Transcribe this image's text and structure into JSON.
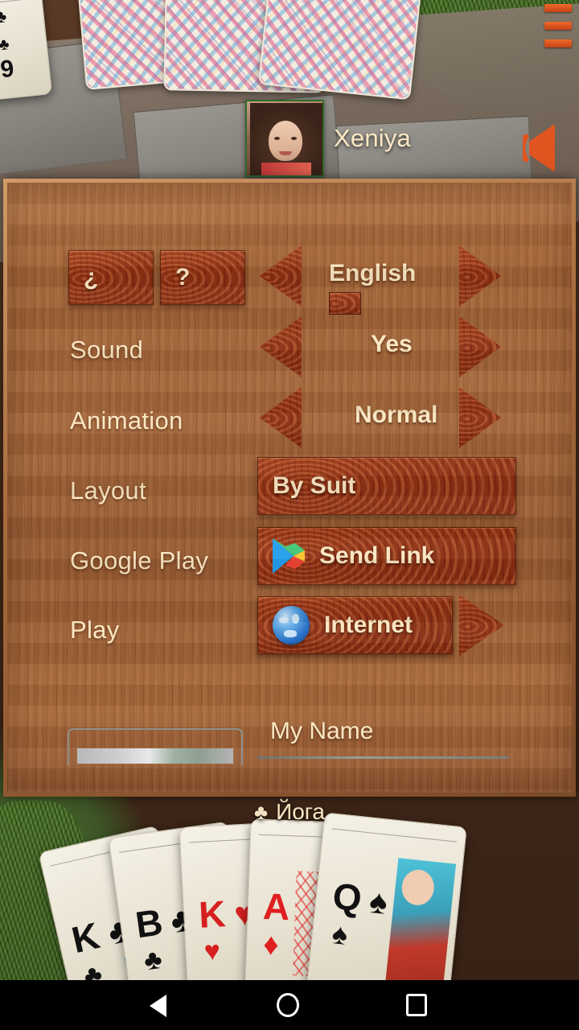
{
  "app": {
    "top_player_name": "Xeniya",
    "trump_suit_symbol": "♣",
    "trump_label": "Йога",
    "menu_icon": "hamburger-menu-icon",
    "sound_speaker_icon": "speaker-icon"
  },
  "settings": {
    "help_button_left": "¿",
    "help_button_right": "?",
    "rows": [
      {
        "label": "",
        "value": "English",
        "left_arrow": "◀",
        "right_arrow": "▶",
        "name": "language"
      },
      {
        "label": "Sound",
        "value": "Yes",
        "left_arrow": "◀",
        "right_arrow": "▶",
        "name": "sound"
      },
      {
        "label": "Animation",
        "value": "Normal",
        "left_arrow": "◀",
        "right_arrow": "▶",
        "name": "animation"
      },
      {
        "label": "Layout",
        "value": "By Suit",
        "name": "layout"
      },
      {
        "label": "Google Play",
        "value": "Send Link",
        "icon": "google-play-icon",
        "name": "google-play"
      },
      {
        "label": "Play",
        "value": "Internet",
        "icon": "globe-icon",
        "right_arrow": "▶",
        "name": "play"
      }
    ],
    "name_field": {
      "label": "My Name",
      "value": ""
    }
  },
  "cards": {
    "opponent_card_backs": 3,
    "side_card": {
      "rank": "9",
      "suit": "♣"
    },
    "hand": [
      {
        "rank": "K",
        "suit": "♣",
        "color": "#111111"
      },
      {
        "rank": "B",
        "suit": "♣",
        "color": "#111111"
      },
      {
        "rank": "K",
        "suit": "♥",
        "color": "#d62020"
      },
      {
        "rank": "A",
        "suit": "♦",
        "color": "#d62020"
      },
      {
        "rank": "Q",
        "suit": "♠",
        "color": "#111111"
      }
    ]
  },
  "navbar": {
    "back": "back-button",
    "home": "home-button",
    "recents": "recents-button"
  },
  "colors": {
    "panel_wood": "#9c5e33",
    "button_wood": "#8e2f14",
    "text_cream": "#fbe8c4",
    "accent_orange": "#e0591f"
  }
}
